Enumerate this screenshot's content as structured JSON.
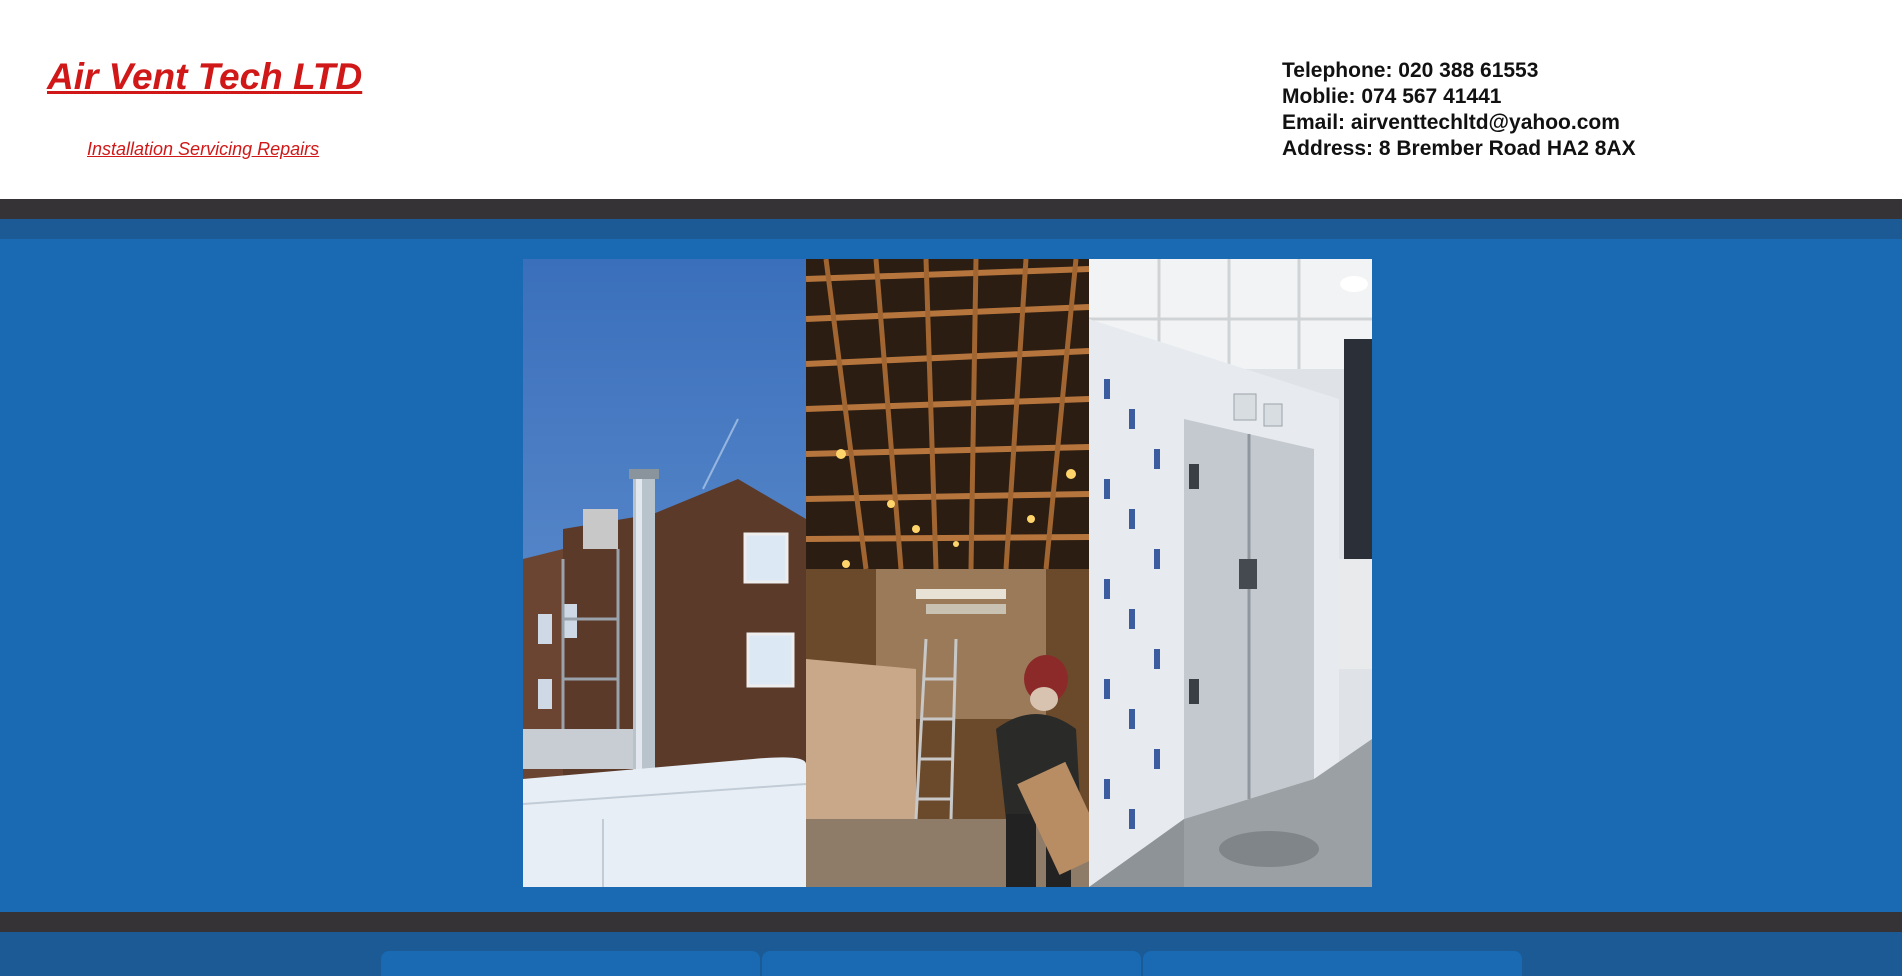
{
  "header": {
    "title": "Air Vent Tech LTD",
    "tagline": "Installation Servicing Repairs",
    "contact": {
      "telephone": "Telephone: 020 388 61553",
      "mobile": "Moblie: 074 567 41441",
      "email": "Email: airventtechltd@yahoo.com",
      "address": "Address: 8 Brember Road HA2 8AX"
    }
  },
  "colors": {
    "brand_red": "#d01818",
    "hero_blue": "#1a6ab3",
    "nav_dark": "#353335",
    "nav_mid": "#1b5a94"
  },
  "gallery": {
    "photos": [
      {
        "name": "building-exterior-flue-photo"
      },
      {
        "name": "ceiling-lights-installation-photo"
      },
      {
        "name": "cold-room-panels-photo"
      }
    ]
  },
  "bottom_nav": {
    "tab_count": 3
  }
}
